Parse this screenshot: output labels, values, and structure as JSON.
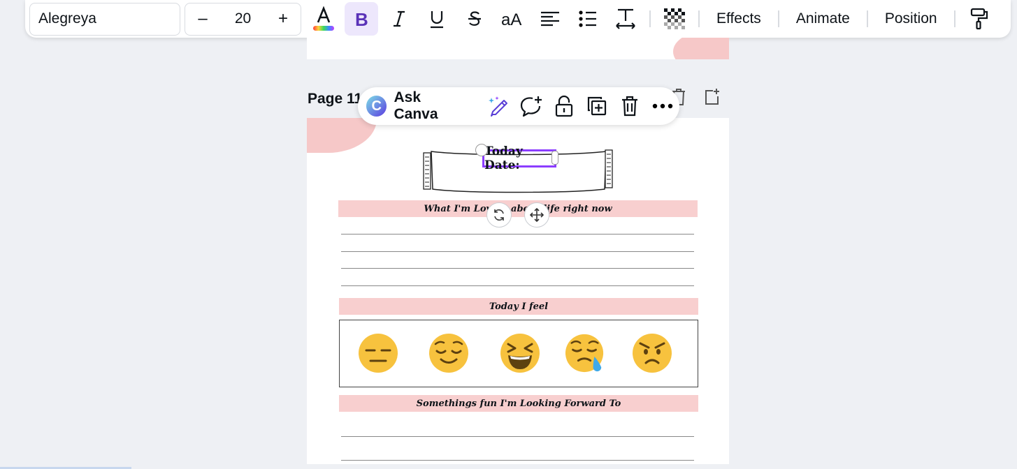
{
  "toolbar": {
    "font_name": "Alegreya",
    "font_size": "20",
    "minus": "–",
    "plus": "+",
    "effects": "Effects",
    "animate": "Animate",
    "position": "Position"
  },
  "ask_bar": {
    "logo": "C",
    "label": "Ask Canva"
  },
  "page": {
    "label": "Page 11",
    "date_text": "Today Date:",
    "section1": "What I'm Loving about life right now",
    "section2": "Today I feel",
    "section3": "Somethings fun I'm Looking Forward To"
  },
  "colors": {
    "accent": "#8b3dff",
    "pink": "#f8cfcf",
    "emoji": "#f7c23e"
  },
  "icons": [
    "text-color-icon",
    "bold-icon",
    "italic-icon",
    "underline-icon",
    "strikethrough-icon",
    "letter-case-icon",
    "align-left-icon",
    "list-icon",
    "spacing-icon",
    "transparency-icon",
    "paint-roller-icon",
    "magic-pen-icon",
    "comment-add-icon",
    "unlock-icon",
    "duplicate-icon",
    "trash-icon",
    "more-icon",
    "rotate-icon",
    "move-icon"
  ]
}
